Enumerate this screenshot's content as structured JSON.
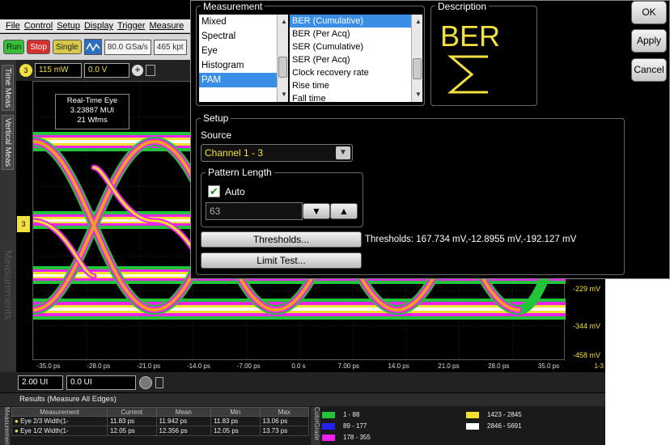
{
  "menu": {
    "items": [
      "File",
      "Control",
      "Setup",
      "Display",
      "Trigger",
      "Measure"
    ]
  },
  "toolbar": {
    "run": "Run",
    "stop": "Stop",
    "single": "Single",
    "sample_rate": "80.0 GSa/s",
    "timebase": "465 kpt"
  },
  "channel": {
    "scale": "115 mW",
    "offset": "0.0 V"
  },
  "left_tabs": {
    "time_meas": "Time Meas",
    "vertical_meas": "Vertical Meas"
  },
  "overlay": {
    "measurements_watermark": "Measurements"
  },
  "tooltip": {
    "line1": "Real-Time Eye",
    "line2": "3.23887 MUI",
    "line3": "21 Wfms"
  },
  "axes": {
    "y_labels": [
      "-229 mV",
      "-344 mV",
      "-458 mV"
    ],
    "x_labels": [
      "-35.0 ps",
      "-28.0 ps",
      "-21.0 ps",
      "-14.0 ps",
      "-7.00 ps",
      "0.0 s",
      "7.00 ps",
      "14.0 ps",
      "21.0 ps",
      "28.0 ps",
      "35.0 ps"
    ],
    "right_marker": "1-3"
  },
  "timebase": {
    "scale": "2.00 UI",
    "position": "0.0 UI"
  },
  "results": {
    "title": "Results   (Measure All Edges)",
    "side_label": "Measurements",
    "columns": [
      "Measurement",
      "Current",
      "Mean",
      "Min",
      "Max"
    ],
    "rows": [
      {
        "name": "Eye 2/3 Width(1-",
        "current": "11.83 ps",
        "mean": "11.942 ps",
        "min": "11.83 ps",
        "max": "13.06 ps"
      },
      {
        "name": "Eye 1/2 Width(1-",
        "current": "12.05 ps",
        "mean": "12.356 ps",
        "min": "12.05 ps",
        "max": "13.73 ps"
      }
    ],
    "color_grade_label": "ColorGrade",
    "legend": [
      {
        "range": "1 - 88",
        "color": "#22c43a"
      },
      {
        "range": "89 - 177",
        "color": "#2222ee"
      },
      {
        "range": "178 - 355",
        "color": "#ee22ee"
      },
      {
        "range": "1423 - 2845",
        "color": "#f0e030"
      },
      {
        "range": "2846 - 5691",
        "color": "#ffffff"
      }
    ]
  },
  "dialog": {
    "measurement_title": "Measurement",
    "categories": [
      "Mixed",
      "Spectral",
      "Eye",
      "Histogram",
      "PAM"
    ],
    "selected_category": "PAM",
    "measurements": [
      "BER (Cumulative)",
      "BER (Per Acq)",
      "SER (Cumulative)",
      "SER (Per Acq)",
      "Clock recovery rate",
      "Rise time",
      "Fall time"
    ],
    "selected_measurement": "BER (Cumulative)",
    "description_title": "Description",
    "description_text": "BER",
    "setup_title": "Setup",
    "source_label": "Source",
    "source_value": "Channel 1 - 3",
    "pattern_title": "Pattern Length",
    "auto_label": "Auto",
    "pattern_value": "63",
    "thresholds_button": "Thresholds...",
    "thresholds_text": "Thresholds: 167.734 mV,-12.8955 mV,-192.127 mV",
    "limit_button": "Limit Test...",
    "ok": "OK",
    "apply": "Apply",
    "cancel": "Cancel"
  }
}
